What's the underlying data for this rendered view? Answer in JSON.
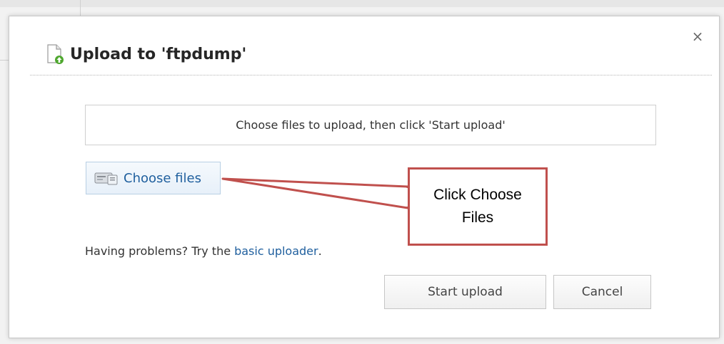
{
  "dialog": {
    "title": "Upload to 'ftpdump'",
    "close_label": "×",
    "instruction": "Choose files to upload, then click 'Start upload'",
    "choose_files_label": "Choose files",
    "problem_prefix": "Having problems? Try the",
    "problem_link": "basic uploader",
    "problem_suffix": ".",
    "start_upload_label": "Start upload",
    "cancel_label": "Cancel"
  },
  "callout": {
    "text": "Click Choose Files"
  },
  "colors": {
    "link": "#1f5f9e",
    "callout_border": "#c0504d",
    "title_text": "#262626"
  },
  "icons": {
    "title": "upload-document-icon",
    "choose_files": "file-drive-icon",
    "close": "close-icon"
  }
}
